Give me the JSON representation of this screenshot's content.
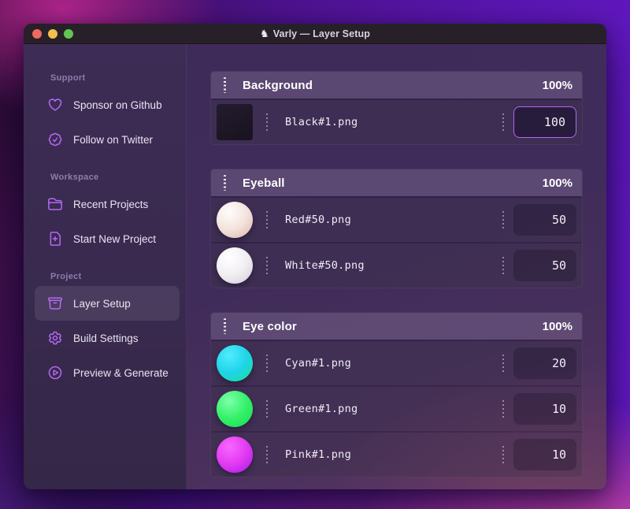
{
  "window": {
    "title": "Varly — Layer Setup",
    "app_icon_glyph": "♞"
  },
  "colors": {
    "accent": "#b469f2",
    "traffic_close": "#ee6a5f",
    "traffic_minimize": "#f5bf4f",
    "traffic_maximize": "#61c554",
    "group_header": "#6b4e8d",
    "focused_input_border": "#b266f0"
  },
  "sidebar": {
    "sections": [
      {
        "label": "Support",
        "items": [
          {
            "icon": "heart-icon",
            "label": "Sponsor on Github",
            "active": false
          },
          {
            "icon": "badge-check-icon",
            "label": "Follow on Twitter",
            "active": false
          }
        ]
      },
      {
        "label": "Workspace",
        "items": [
          {
            "icon": "folder-icon",
            "label": "Recent Projects",
            "active": false
          },
          {
            "icon": "document-plus-icon",
            "label": "Start New Project",
            "active": false
          }
        ]
      },
      {
        "label": "Project",
        "items": [
          {
            "icon": "archive-box-icon",
            "label": "Layer Setup",
            "active": true
          },
          {
            "icon": "gear-icon",
            "label": "Build Settings",
            "active": false
          },
          {
            "icon": "play-circle-icon",
            "label": "Preview & Generate",
            "active": false
          }
        ]
      }
    ]
  },
  "layers": {
    "groups": [
      {
        "name": "Background",
        "weight": "100%",
        "items": [
          {
            "file": "Black#1.png",
            "value": "100",
            "thumb": "black-square",
            "focused": true
          }
        ]
      },
      {
        "name": "Eyeball",
        "weight": "100%",
        "items": [
          {
            "file": "Red#50.png",
            "value": "50",
            "thumb": "red-sphere",
            "focused": false
          },
          {
            "file": "White#50.png",
            "value": "50",
            "thumb": "white-sphere",
            "focused": false
          }
        ]
      },
      {
        "name": "Eye color",
        "weight": "100%",
        "items": [
          {
            "file": "Cyan#1.png",
            "value": "20",
            "thumb": "cyan-sphere",
            "focused": false
          },
          {
            "file": "Green#1.png",
            "value": "10",
            "thumb": "green-sphere",
            "focused": false
          },
          {
            "file": "Pink#1.png",
            "value": "10",
            "thumb": "pink-sphere",
            "focused": false
          }
        ]
      }
    ]
  },
  "thumbs": {
    "black-square": {
      "shape": "square",
      "stops": [
        "#241c2e",
        "#18121f"
      ]
    },
    "red-sphere": {
      "shape": "circle",
      "stops": [
        "#fffdfb",
        "#f4e3dd",
        "#dcb2aa"
      ]
    },
    "white-sphere": {
      "shape": "circle",
      "stops": [
        "#ffffff",
        "#f2eff3",
        "#cfc8d4"
      ]
    },
    "cyan-sphere": {
      "shape": "circle",
      "stops": [
        "#52ecff",
        "#1fd4e8",
        "#14e392"
      ]
    },
    "green-sphere": {
      "shape": "circle",
      "stops": [
        "#7dffab",
        "#35f169",
        "#12dd52"
      ]
    },
    "pink-sphere": {
      "shape": "circle",
      "stops": [
        "#f867ff",
        "#e33bf2",
        "#a617e8"
      ]
    }
  }
}
